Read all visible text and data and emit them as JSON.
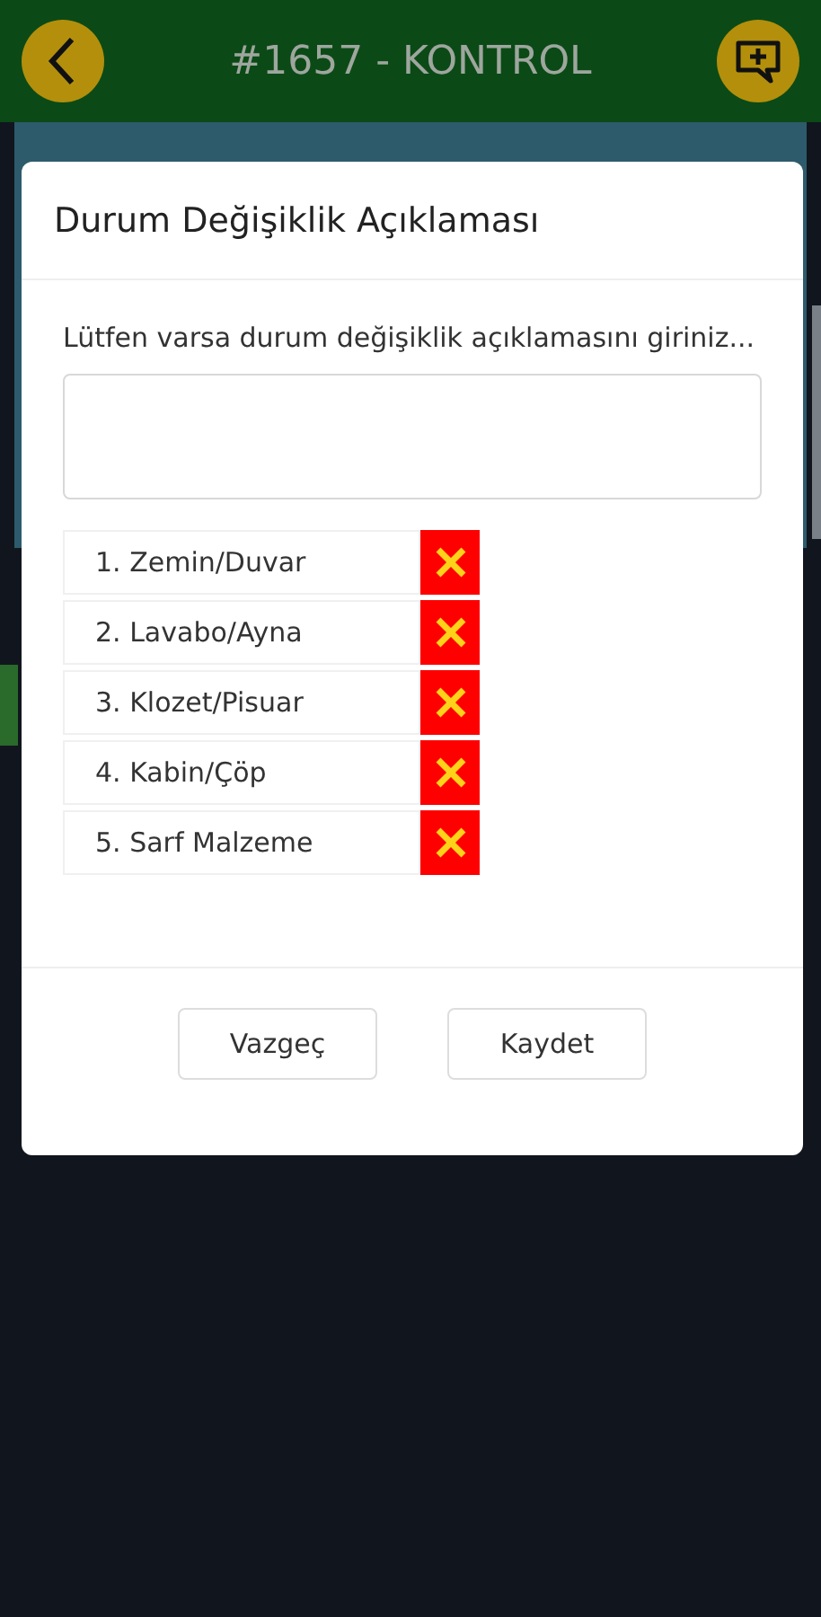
{
  "header": {
    "title": "#1657 - KONTROL"
  },
  "dialog": {
    "title": "Durum Değişiklik Açıklaması",
    "prompt": "Lütfen varsa durum değişiklik açıklamasını giriniz...",
    "items": [
      {
        "label": "1. Zemin/Duvar",
        "ok": false
      },
      {
        "label": "2. Lavabo/Ayna",
        "ok": false
      },
      {
        "label": "3. Klozet/Pisuar",
        "ok": false
      },
      {
        "label": "4. Kabin/Çöp",
        "ok": false
      },
      {
        "label": "5. Sarf Malzeme",
        "ok": false
      }
    ],
    "buttons": [
      "Vazgeç",
      "Kaydet"
    ]
  }
}
